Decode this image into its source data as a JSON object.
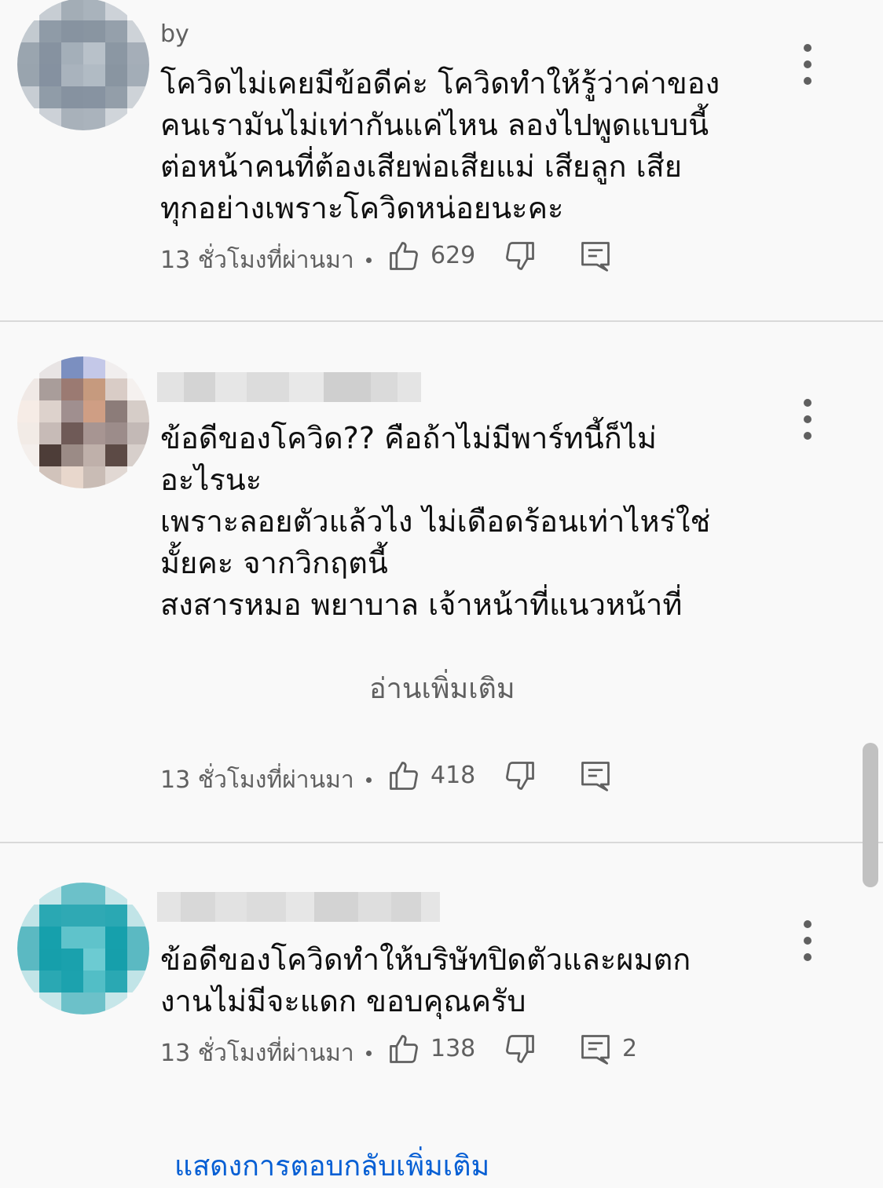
{
  "comments": [
    {
      "author": "by",
      "text": "โควิดไม่เคยมีข้อดีค่ะ โควิดทำให้รู้ว่าค่าของ\nคนเรามันไม่เท่ากันแค่ไหน ลองไปพูดแบบนี้\nต่อหน้าคนที่ต้องเสียพ่อเสียแม่ เสียลูก เสีย\nทุกอย่างเพราะโควิดหน่อยนะคะ",
      "time": "13 ชั่วโมงที่ผ่านมา",
      "likes": "629"
    },
    {
      "author": "",
      "text": "ข้อดีของโควิด?? คือถ้าไม่มีพาร์ทนี้ก็ไม่\nอะไรนะ\nเพราะลอยตัวแล้วไง ไม่เดือดร้อนเท่าไหร่ใช่\nมั้ยคะ จากวิกฤตนี้\nสงสารหมอ พยาบาล เจ้าหน้าที่แนวหน้าที่",
      "read_more": "อ่านเพิ่มเติม",
      "time": "13 ชั่วโมงที่ผ่านมา",
      "likes": "418"
    },
    {
      "author": "",
      "text": "ข้อดีของโควิดทำให้บริษัทปิดตัวและผมตก\nงานไม่มีจะแดก ขอบคุณครับ",
      "time": "13 ชั่วโมงที่ผ่านมา",
      "likes": "138",
      "replies": "2"
    }
  ],
  "show_more_replies": "แสดงการตอบกลับเพิ่มเติม",
  "icons": {
    "like": "thumbs-up-icon",
    "dislike": "thumbs-down-icon",
    "reply": "reply-icon",
    "menu": "more-vert-icon"
  },
  "colors": {
    "background": "#f9f9f9",
    "text": "#0f0f0f",
    "secondary": "#606060",
    "link": "#065fd4"
  }
}
